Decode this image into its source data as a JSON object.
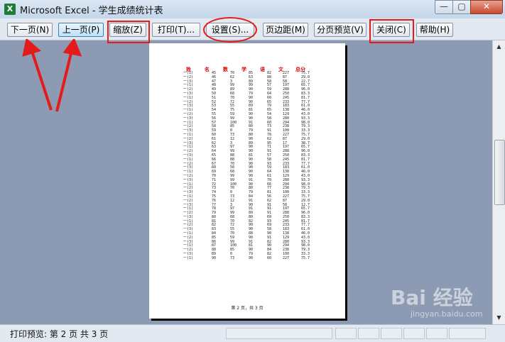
{
  "window": {
    "title": "Microsoft Excel - 学生成绩统计表",
    "app_icon": "X"
  },
  "window_controls": {
    "minimize": "—",
    "maximize": "▢",
    "close": "✕"
  },
  "toolbar": {
    "buttons": [
      {
        "label": "下一页(N)"
      },
      {
        "label": "上一页(P)"
      },
      {
        "label": "缩放(Z)"
      },
      {
        "label": "打印(T)..."
      },
      {
        "label": "设置(S)..."
      },
      {
        "label": "页边距(M)"
      },
      {
        "label": "分页预览(V)"
      },
      {
        "label": "关闭(C)"
      },
      {
        "label": "帮助(H)"
      }
    ]
  },
  "page": {
    "header": [
      "姓",
      "名",
      "数",
      "学",
      "语",
      "文",
      "总分"
    ],
    "footer": "第 2 页，共 3 页",
    "rows": [
      [
        "一(1)",
        "45",
        "70",
        "85",
        "82",
        "227",
        "75.7"
      ],
      [
        "一(2)",
        "46",
        "62",
        "63",
        "88",
        "87",
        "29.0"
      ],
      [
        "一(3)",
        "47",
        "3",
        "89",
        "58",
        "58",
        "22.7"
      ],
      [
        "一(1)",
        "48",
        "99",
        "99",
        "57",
        "197",
        "65.7"
      ],
      [
        "一(2)",
        "49",
        "89",
        "90",
        "59",
        "288",
        "96.0"
      ],
      [
        "一(3)",
        "50",
        "68",
        "79",
        "64",
        "250",
        "83.3"
      ],
      [
        "一(1)",
        "51",
        "70",
        "90",
        "60",
        "245",
        "81.7"
      ],
      [
        "一(2)",
        "52",
        "72",
        "90",
        "65",
        "233",
        "77.7"
      ],
      [
        "一(3)",
        "53",
        "55",
        "89",
        "79",
        "183",
        "61.0"
      ],
      [
        "一(1)",
        "54",
        "75",
        "81",
        "65",
        "138",
        "46.0"
      ],
      [
        "一(2)",
        "55",
        "59",
        "90",
        "54",
        "129",
        "43.0"
      ],
      [
        "一(3)",
        "56",
        "99",
        "90",
        "58",
        "280",
        "93.3"
      ],
      [
        "一(1)",
        "57",
        "100",
        "91",
        "60",
        "294",
        "98.0"
      ],
      [
        "一(2)",
        "58",
        "85",
        "80",
        "73",
        "238",
        "79.3"
      ],
      [
        "一(3)",
        "59",
        "0",
        "79",
        "91",
        "100",
        "33.3"
      ],
      [
        "一(1)",
        "60",
        "73",
        "80",
        "78",
        "227",
        "75.7"
      ],
      [
        "一(2)",
        "61",
        "12",
        "90",
        "62",
        "87",
        "29.0"
      ],
      [
        "一(3)",
        "62",
        "3",
        "89",
        "95",
        "17",
        "38.7"
      ],
      [
        "一(1)",
        "63",
        "97",
        "90",
        "71",
        "197",
        "65.7"
      ],
      [
        "一(2)",
        "64",
        "99",
        "90",
        "91",
        "288",
        "96.0"
      ],
      [
        "一(3)",
        "65",
        "88",
        "81",
        "57",
        "250",
        "83.3"
      ],
      [
        "一(1)",
        "66",
        "88",
        "90",
        "58",
        "245",
        "81.7"
      ],
      [
        "一(2)",
        "67",
        "70",
        "90",
        "93",
        "233",
        "77.7"
      ],
      [
        "一(3)",
        "68",
        "58",
        "90",
        "59",
        "183",
        "61.0"
      ],
      [
        "一(1)",
        "69",
        "68",
        "90",
        "64",
        "138",
        "46.0"
      ],
      [
        "一(2)",
        "70",
        "99",
        "90",
        "61",
        "129",
        "43.0"
      ],
      [
        "一(3)",
        "71",
        "99",
        "91",
        "70",
        "280",
        "93.3"
      ],
      [
        "一(1)",
        "72",
        "100",
        "90",
        "66",
        "294",
        "98.0"
      ],
      [
        "一(2)",
        "73",
        "70",
        "80",
        "77",
        "238",
        "79.3"
      ],
      [
        "一(3)",
        "74",
        "0",
        "79",
        "81",
        "100",
        "33.3"
      ],
      [
        "一(1)",
        "75",
        "73",
        "84",
        "56",
        "227",
        "75.7"
      ],
      [
        "一(2)",
        "76",
        "12",
        "91",
        "62",
        "87",
        "29.0"
      ],
      [
        "一(3)",
        "77",
        "3",
        "90",
        "91",
        "58",
        "12.7"
      ],
      [
        "一(1)",
        "78",
        "97",
        "91",
        "91",
        "197",
        "65.7"
      ],
      [
        "一(2)",
        "79",
        "99",
        "89",
        "91",
        "288",
        "96.0"
      ],
      [
        "一(3)",
        "80",
        "68",
        "80",
        "69",
        "250",
        "83.3"
      ],
      [
        "一(1)",
        "81",
        "70",
        "82",
        "93",
        "245",
        "81.7"
      ],
      [
        "一(2)",
        "82",
        "72",
        "90",
        "69",
        "233",
        "77.7"
      ],
      [
        "一(3)",
        "83",
        "55",
        "90",
        "58",
        "183",
        "61.0"
      ],
      [
        "一(1)",
        "84",
        "70",
        "88",
        "90",
        "138",
        "46.0"
      ],
      [
        "一(2)",
        "85",
        "59",
        "90",
        "91",
        "129",
        "43.0"
      ],
      [
        "一(3)",
        "86",
        "99",
        "91",
        "82",
        "280",
        "93.3"
      ],
      [
        "一(1)",
        "87",
        "100",
        "81",
        "90",
        "294",
        "98.0"
      ],
      [
        "一(2)",
        "88",
        "85",
        "90",
        "84",
        "238",
        "79.3"
      ],
      [
        "一(3)",
        "89",
        "0",
        "79",
        "82",
        "100",
        "33.3"
      ],
      [
        "一(1)",
        "90",
        "73",
        "90",
        "60",
        "227",
        "75.7"
      ]
    ]
  },
  "status": {
    "text": "打印预览: 第 2 页  共 3 页"
  },
  "watermark": {
    "brand": "Bai 经验",
    "url": "jingyan.baidu.com"
  },
  "annotation_color": "#e41b1b"
}
